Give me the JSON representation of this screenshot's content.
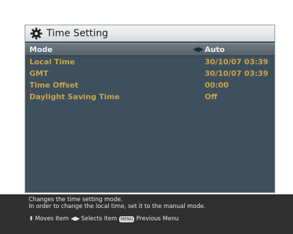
{
  "window": {
    "title": "Time Setting",
    "icon": "gear-icon"
  },
  "rows": [
    {
      "label": "Mode",
      "value": "Auto",
      "selected": true
    },
    {
      "label": "Local Time",
      "value": "30/10/07 03:39"
    },
    {
      "label": "GMT",
      "value": "30/10/07 03:39"
    },
    {
      "label": "Time Offset",
      "value": "00:00"
    },
    {
      "label": "Daylight Saving Time",
      "value": "Off"
    }
  ],
  "footer": {
    "help_line1": "Changes the time setting mode.",
    "help_line2": "In order to change the local time, set it to the manual mode.",
    "hint_move": "Moves Item",
    "hint_select": "Selects Item",
    "menu_key": "MENU",
    "hint_previous": "Previous Menu"
  },
  "colors": {
    "panel": "#3e4f5d",
    "label_text": "#c9a64a",
    "selected_text": "#f3f3f3",
    "footer_bg": "#2f2f2f"
  }
}
